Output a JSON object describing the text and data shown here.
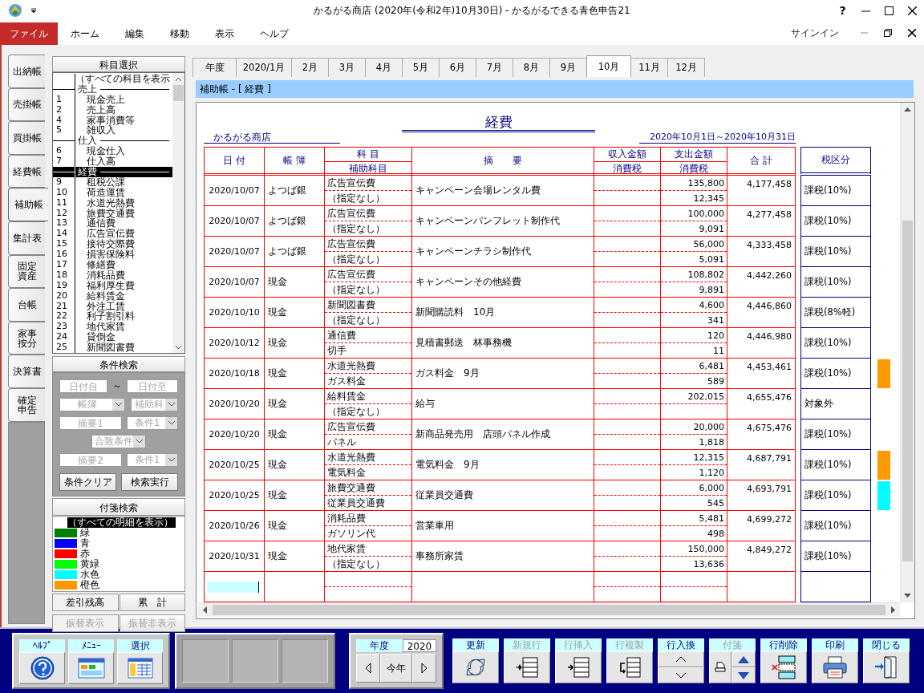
{
  "window": {
    "title": "かるがる商店 (2020年(令和2年)10月30日) - かるがるできる青色申告21",
    "help": "?"
  },
  "menu": {
    "items": [
      {
        "label": "ファイル",
        "selected": true
      },
      {
        "label": "ホーム",
        "selected": false
      },
      {
        "label": "編集",
        "selected": false
      },
      {
        "label": "移動",
        "selected": false
      },
      {
        "label": "表示",
        "selected": false
      },
      {
        "label": "ヘルプ",
        "selected": false
      }
    ],
    "signin": "サインイン"
  },
  "side_tabs": [
    {
      "label": "出納帳",
      "selected": false
    },
    {
      "label": "売掛帳",
      "selected": false
    },
    {
      "label": "買掛帳",
      "selected": false
    },
    {
      "label": "経費帳",
      "selected": false
    },
    {
      "label": "補助帳",
      "selected": true
    },
    {
      "label": "集計表",
      "selected": false
    },
    {
      "label": "固定資産",
      "selected": false
    },
    {
      "label": "台帳",
      "selected": false
    },
    {
      "label": "家事按分",
      "selected": false
    },
    {
      "label": "決算書",
      "selected": false
    },
    {
      "label": "確定申告",
      "selected": false
    }
  ],
  "account_select": {
    "title": "科目選択",
    "items": [
      {
        "kind": "all",
        "label": "（すべての科目を表示",
        "selected": false
      },
      {
        "kind": "group",
        "label": "売上",
        "selected": false
      },
      {
        "kind": "account",
        "code": "1",
        "label": "現金売上",
        "selected": false
      },
      {
        "kind": "account",
        "code": "2",
        "label": "売上高",
        "selected": false
      },
      {
        "kind": "account",
        "code": "4",
        "label": "家事消費等",
        "selected": false
      },
      {
        "kind": "account",
        "code": "5",
        "label": "雑収入",
        "selected": false
      },
      {
        "kind": "group",
        "label": "仕入",
        "selected": false
      },
      {
        "kind": "account",
        "code": "6",
        "label": "現金仕入",
        "selected": false
      },
      {
        "kind": "account",
        "code": "7",
        "label": "仕入高",
        "selected": false
      },
      {
        "kind": "group",
        "label": "経費",
        "selected": true
      },
      {
        "kind": "account",
        "code": "9",
        "label": "租税公課",
        "selected": false
      },
      {
        "kind": "account",
        "code": "10",
        "label": "荷造運賃",
        "selected": false
      },
      {
        "kind": "account",
        "code": "11",
        "label": "水道光熱費",
        "selected": false
      },
      {
        "kind": "account",
        "code": "12",
        "label": "旅費交通費",
        "selected": false
      },
      {
        "kind": "account",
        "code": "13",
        "label": "通信費",
        "selected": false
      },
      {
        "kind": "account",
        "code": "14",
        "label": "広告宣伝費",
        "selected": false
      },
      {
        "kind": "account",
        "code": "15",
        "label": "接待交際費",
        "selected": false
      },
      {
        "kind": "account",
        "code": "16",
        "label": "損害保険料",
        "selected": false
      },
      {
        "kind": "account",
        "code": "17",
        "label": "修繕費",
        "selected": false
      },
      {
        "kind": "account",
        "code": "18",
        "label": "消耗品費",
        "selected": false
      },
      {
        "kind": "account",
        "code": "19",
        "label": "福利厚生費",
        "selected": false
      },
      {
        "kind": "account",
        "code": "20",
        "label": "給料賃金",
        "selected": false
      },
      {
        "kind": "account",
        "code": "21",
        "label": "外注工賃",
        "selected": false
      },
      {
        "kind": "account",
        "code": "22",
        "label": "利子割引料",
        "selected": false
      },
      {
        "kind": "account",
        "code": "23",
        "label": "地代家賃",
        "selected": false
      },
      {
        "kind": "account",
        "code": "24",
        "label": "貸倒金",
        "selected": false
      },
      {
        "kind": "account",
        "code": "25",
        "label": "新聞図書費",
        "selected": false
      }
    ]
  },
  "condition_search": {
    "title": "条件検索",
    "rows": [
      [
        {
          "kind": "text",
          "placeholder": "日付自",
          "disabled": true
        },
        {
          "kind": "separator",
          "label": "～"
        },
        {
          "kind": "text",
          "placeholder": "日付至",
          "disabled": true
        }
      ],
      [
        {
          "kind": "combo",
          "value": "帳簿",
          "disabled": true
        },
        {
          "kind": "combo",
          "value": "補助科",
          "disabled": true
        }
      ],
      [
        {
          "kind": "text",
          "placeholder": "摘要1",
          "disabled": true
        },
        {
          "kind": "combo",
          "value": "条件1",
          "disabled": true
        }
      ],
      [
        {
          "kind": "combo",
          "value": "合致条件",
          "disabled": true
        }
      ],
      [
        {
          "kind": "text",
          "placeholder": "摘要2",
          "disabled": true
        },
        {
          "kind": "combo",
          "value": "条件1",
          "disabled": true
        }
      ]
    ],
    "buttons": [
      "条件クリア",
      "検索実行"
    ]
  },
  "tag_search": {
    "title": "付箋検索",
    "items": [
      {
        "label": "（すべての明細を表示）",
        "selected": true
      },
      {
        "label": "緑",
        "color": "#008000",
        "selected": false
      },
      {
        "label": "青",
        "color": "#0000ff",
        "selected": false
      },
      {
        "label": "赤",
        "color": "#ff0000",
        "selected": false
      },
      {
        "label": "黄緑",
        "color": "#00ff00",
        "selected": false
      },
      {
        "label": "水色",
        "color": "#00ffff",
        "selected": false
      },
      {
        "label": "橙色",
        "color": "#ff9900",
        "selected": false
      }
    ]
  },
  "balance_tabs": [
    {
      "label": "差引残高",
      "selected": true
    },
    {
      "label": "累　計",
      "selected": false
    }
  ],
  "transfer_tabs": [
    {
      "label": "振替表示",
      "selected": true,
      "disabled": true
    },
    {
      "label": "振替非表示",
      "selected": false,
      "disabled": true
    }
  ],
  "month_tabs": [
    {
      "label": "年度",
      "selected": false
    },
    {
      "label": "2020/1月",
      "selected": false
    },
    {
      "label": "2月",
      "selected": false
    },
    {
      "label": "3月",
      "selected": false
    },
    {
      "label": "4月",
      "selected": false
    },
    {
      "label": "5月",
      "selected": false
    },
    {
      "label": "6月",
      "selected": false
    },
    {
      "label": "7月",
      "selected": false
    },
    {
      "label": "8月",
      "selected": false
    },
    {
      "label": "9月",
      "selected": false
    },
    {
      "label": "10月",
      "selected": true
    },
    {
      "label": "11月",
      "selected": false
    },
    {
      "label": "12月",
      "selected": false
    }
  ],
  "ledger_bar": {
    "title": "補助帳 - [ 経費 ]"
  },
  "report": {
    "title": "経費",
    "company": "かるがる商店",
    "period": "2020年10月1日～2020年10月31日",
    "columns": {
      "date": "日 付",
      "book": "帳 簿",
      "account": "科 目",
      "sub_account": "補助科目",
      "description": "摘　　要",
      "income": "収入金額",
      "income_tax": "消費税",
      "expense": "支出金額",
      "expense_tax": "消費税",
      "total": "合 計",
      "tax_class": "税区分"
    },
    "rows": [
      {
        "date": "2020/10/07",
        "book": "よつば銀",
        "account": "広告宣伝費",
        "sub_account": "（指定なし）",
        "description": "キャンペーン会場レンタル費",
        "expense": "135,800",
        "expense_tax": "12,345",
        "total": "4,177,458",
        "tax_class": "課税(10%)"
      },
      {
        "date": "2020/10/07",
        "book": "よつば銀",
        "account": "広告宣伝費",
        "sub_account": "（指定なし）",
        "description": "キャンペーンパンフレット制作代",
        "expense": "100,000",
        "expense_tax": "9,091",
        "total": "4,277,458",
        "tax_class": "課税(10%)"
      },
      {
        "date": "2020/10/07",
        "book": "よつば銀",
        "account": "広告宣伝費",
        "sub_account": "（指定なし）",
        "description": "キャンペーンチラシ制作代",
        "expense": "56,000",
        "expense_tax": "5,091",
        "total": "4,333,458",
        "tax_class": "課税(10%)"
      },
      {
        "date": "2020/10/07",
        "book": "現金",
        "account": "広告宣伝費",
        "sub_account": "（指定なし）",
        "description": "キャンペーンその他経費",
        "expense": "108,802",
        "expense_tax": "9,891",
        "total": "4,442,260",
        "tax_class": "課税(10%)"
      },
      {
        "date": "2020/10/10",
        "book": "現金",
        "account": "新聞図書費",
        "sub_account": "（指定なし）",
        "description": "新聞購読料　10月",
        "expense": "4,600",
        "expense_tax": "341",
        "total": "4,446,860",
        "tax_class": "課税(8%軽)"
      },
      {
        "date": "2020/10/12",
        "book": "現金",
        "account": "通信費",
        "sub_account": "切手",
        "description": "見積書郵送　林事務機",
        "expense": "120",
        "expense_tax": "11",
        "total": "4,446,980",
        "tax_class": "課税(10%)"
      },
      {
        "date": "2020/10/18",
        "book": "現金",
        "account": "水道光熱費",
        "sub_account": "ガス料金",
        "description": "ガス料金　9月",
        "expense": "6,481",
        "expense_tax": "589",
        "total": "4,453,461",
        "tax_class": "課税(10%)",
        "color": "#ff9900"
      },
      {
        "date": "2020/10/20",
        "book": "現金",
        "account": "給料賃金",
        "sub_account": "（指定なし）",
        "description": "給与",
        "expense": "202,015",
        "total": "4,655,476",
        "tax_class": "対象外"
      },
      {
        "date": "2020/10/20",
        "book": "現金",
        "account": "広告宣伝費",
        "sub_account": "パネル",
        "description": "新商品発売用　店頭パネル作成",
        "expense": "20,000",
        "expense_tax": "1,818",
        "total": "4,675,476",
        "tax_class": "課税(10%)"
      },
      {
        "date": "2020/10/25",
        "book": "現金",
        "account": "水道光熱費",
        "sub_account": "電気料金",
        "description": "電気料金　9月",
        "expense": "12,315",
        "expense_tax": "1,120",
        "total": "4,687,791",
        "tax_class": "課税(10%)",
        "color": "#ff9900"
      },
      {
        "date": "2020/10/25",
        "book": "現金",
        "account": "旅費交通費",
        "sub_account": "従業員交通費",
        "description": "従業員交通費",
        "expense": "6,000",
        "expense_tax": "545",
        "total": "4,693,791",
        "tax_class": "課税(10%)",
        "color": "#00ffff"
      },
      {
        "date": "2020/10/26",
        "book": "現金",
        "account": "消耗品費",
        "sub_account": "ガソリン代",
        "description": "営業車用",
        "expense": "5,481",
        "expense_tax": "498",
        "total": "4,699,272",
        "tax_class": "課税(10%)"
      },
      {
        "date": "2020/10/31",
        "book": "現金",
        "account": "地代家賃",
        "sub_account": "（指定なし）",
        "description": "事務所家賃",
        "expense": "150,000",
        "expense_tax": "13,636",
        "total": "4,849,272",
        "tax_class": "課税(10%)"
      }
    ]
  },
  "toolbar": {
    "nav_buttons": [
      {
        "label": "ﾍﾙﾌﾟ",
        "kind": "help"
      },
      {
        "label": "ﾒﾆｭｰ",
        "kind": "menu"
      },
      {
        "label": "選択",
        "kind": "select"
      }
    ],
    "year": {
      "label": "年度",
      "value": "2020",
      "today": "今年"
    },
    "actions": [
      {
        "label": "更新",
        "kind": "refresh",
        "disabled": false
      },
      {
        "label": "新規行",
        "kind": "new_row",
        "disabled": true
      },
      {
        "label": "行挿入",
        "kind": "insert",
        "disabled": true
      },
      {
        "label": "行複製",
        "kind": "duplicate",
        "disabled": true
      },
      {
        "label": "行入換",
        "kind": "swap",
        "disabled": false
      },
      {
        "label": "付箋",
        "kind": "tag",
        "disabled": true
      },
      {
        "label": "行削除",
        "kind": "delete",
        "disabled": false
      },
      {
        "label": "印刷",
        "kind": "print",
        "disabled": false
      },
      {
        "label": "閉じる",
        "kind": "close",
        "disabled": false
      }
    ]
  }
}
